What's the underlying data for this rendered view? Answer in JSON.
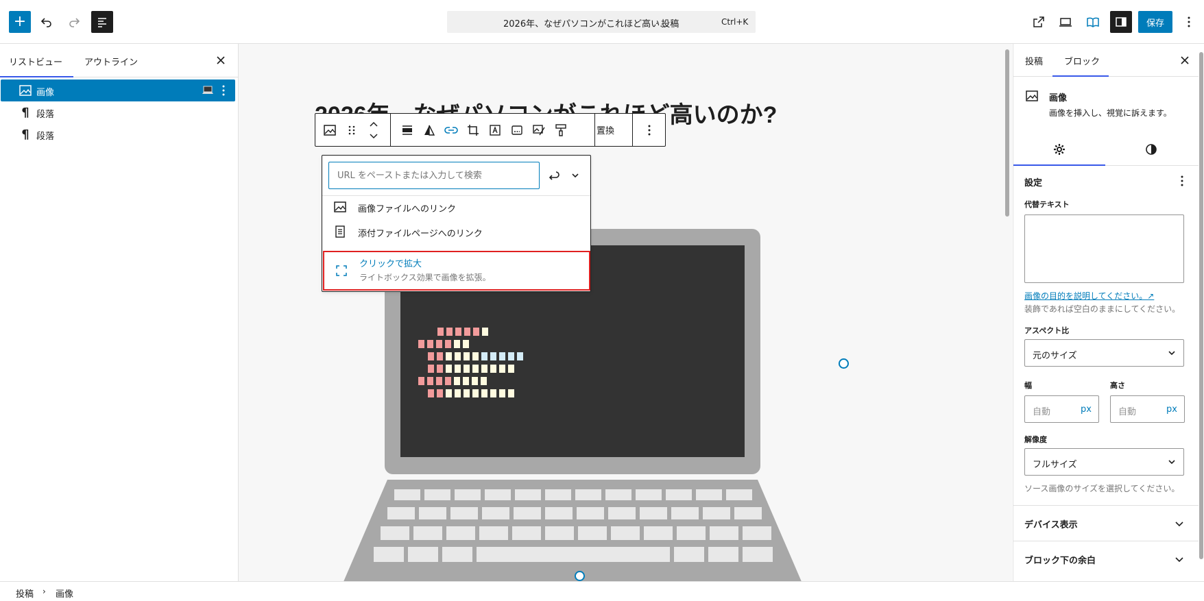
{
  "header": {
    "title": "2026年、なぜパソコンがこれほど高い…",
    "post_type": "· 投稿",
    "shortcut": "Ctrl+K",
    "save_label": "保存",
    "colors": {
      "accent": "#007cba",
      "dark": "#1e1e1e"
    }
  },
  "left_panel": {
    "tabs": [
      {
        "label": "リストビュー"
      },
      {
        "label": "アウトライン"
      }
    ],
    "items": [
      {
        "label": "画像",
        "icon": "image-icon"
      },
      {
        "label": "段落",
        "icon": "paragraph-icon"
      },
      {
        "label": "段落",
        "icon": "paragraph-icon"
      }
    ]
  },
  "editor": {
    "post_title": "2026年、なぜパソコンがこれほど高いのか?",
    "toolbar": {
      "replace_label": "置換"
    }
  },
  "link_popover": {
    "placeholder": "URL をペーストまたは入力して検索",
    "options": [
      {
        "label": "画像ファイルへのリンク",
        "icon": "image-icon"
      },
      {
        "label": "添付ファイルページへのリンク",
        "icon": "page-icon"
      }
    ],
    "highlighted_option": {
      "label": "クリックで拡大",
      "description": "ライトボックス効果で画像を拡張。",
      "icon": "fullscreen-icon"
    }
  },
  "right_panel": {
    "tabs": [
      {
        "label": "投稿"
      },
      {
        "label": "ブロック"
      }
    ],
    "block_title": "画像",
    "block_description": "画像を挿入し、視覚に訴えます。",
    "settings_title": "設定",
    "alt_text_label": "代替テキスト",
    "alt_text_link": "画像の目的を説明してください。↗",
    "alt_text_help": "装飾であれば空白のままにしてください。",
    "aspect_ratio_label": "アスペクト比",
    "aspect_ratio_value": "元のサイズ",
    "width_label": "幅",
    "height_label": "高さ",
    "width_placeholder": "自動",
    "height_placeholder": "自動",
    "unit": "px",
    "resolution_label": "解像度",
    "resolution_value": "フルサイズ",
    "resolution_help": "ソース画像のサイズを選択してください。",
    "panels": [
      {
        "title": "デバイス表示"
      },
      {
        "title": "ブロック下の余白"
      }
    ]
  },
  "footer": {
    "breadcrumb": [
      {
        "label": "投稿"
      },
      {
        "label": "画像"
      }
    ]
  }
}
